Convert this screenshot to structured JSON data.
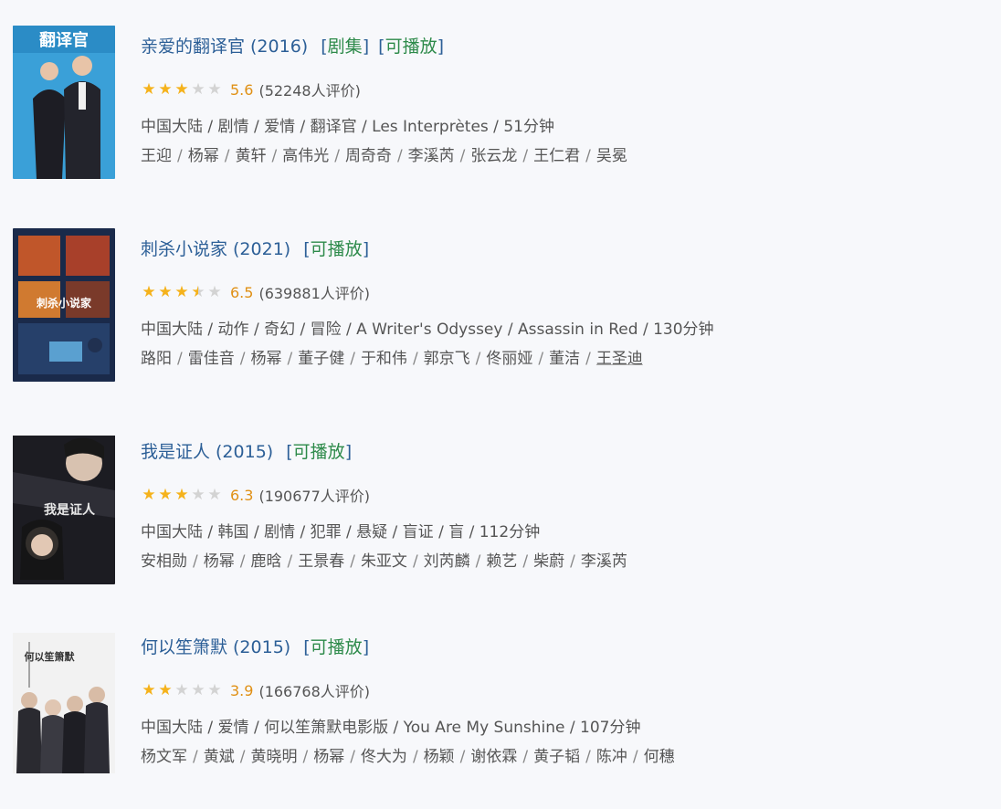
{
  "items": [
    {
      "title": "亲爱的翻译官",
      "year": "(2016)",
      "tags": [
        "剧集",
        "可播放"
      ],
      "stars": [
        "full",
        "full",
        "full",
        "empty",
        "empty"
      ],
      "score": "5.6",
      "votes": "(52248人评价)",
      "meta": "中国大陆 / 剧情 / 爱情 / 翻译官 / Les Interprètes / 51分钟",
      "cast": [
        "王迎",
        "杨幂",
        "黄轩",
        "高伟光",
        "周奇奇",
        "李溪芮",
        "张云龙",
        "王仁君",
        "吴冕"
      ],
      "poster_text": "翻译官",
      "colors": {
        "bg": "#3aa0d8"
      }
    },
    {
      "title": "刺杀小说家",
      "year": "(2021)",
      "tags": [
        "可播放"
      ],
      "stars": [
        "full",
        "full",
        "full",
        "half",
        "empty"
      ],
      "score": "6.5",
      "votes": "(639881人评价)",
      "meta": "中国大陆 / 动作 / 奇幻 / 冒险 / A Writer's Odyssey / Assassin in Red / 130分钟",
      "cast": [
        "路阳",
        "雷佳音",
        "杨幂",
        "董子健",
        "于和伟",
        "郭京飞",
        "佟丽娅",
        "董洁",
        "王圣迪"
      ],
      "poster_text": "刺杀小说家",
      "colors": {
        "bg": "#1a2a4a"
      }
    },
    {
      "title": "我是证人",
      "year": "(2015)",
      "tags": [
        "可播放"
      ],
      "stars": [
        "full",
        "full",
        "full",
        "empty",
        "empty"
      ],
      "score": "6.3",
      "votes": "(190677人评价)",
      "meta": "中国大陆 / 韩国 / 剧情 / 犯罪 / 悬疑 / 盲证 / 盲 / 112分钟",
      "cast": [
        "安相勋",
        "杨幂",
        "鹿晗",
        "王景春",
        "朱亚文",
        "刘芮麟",
        "赖艺",
        "柴蔚",
        "李溪芮"
      ],
      "poster_text": "我是证人",
      "colors": {
        "bg": "#1c1c22"
      }
    },
    {
      "title": "何以笙箫默",
      "year": "(2015)",
      "tags": [
        "可播放"
      ],
      "stars": [
        "full",
        "full",
        "empty",
        "empty",
        "empty"
      ],
      "score": "3.9",
      "votes": "(166768人评价)",
      "meta": "中国大陆 / 爱情 / 何以笙箫默电影版 / You Are My Sunshine / 107分钟",
      "cast": [
        "杨文军",
        "黄斌",
        "黄晓明",
        "杨幂",
        "佟大为",
        "杨颖",
        "谢依霖",
        "黄子韬",
        "陈冲",
        "何穗"
      ],
      "poster_text": "何以笙箫默",
      "colors": {
        "bg": "#f2f2f2"
      }
    }
  ]
}
